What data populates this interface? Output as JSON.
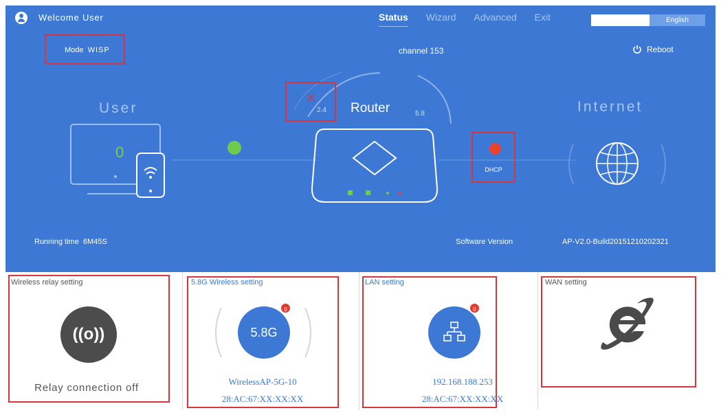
{
  "header": {
    "welcome": "Welcome User",
    "nav": [
      {
        "label": "Status",
        "active": true
      },
      {
        "label": "Wizard",
        "active": false
      },
      {
        "label": "Advanced",
        "active": false
      },
      {
        "label": "Exit",
        "active": false
      }
    ],
    "language": "English"
  },
  "status": {
    "mode_label": "Mode",
    "mode_value": "WISP",
    "channel": "channel 153",
    "reboot": "Reboot",
    "user_label": "User",
    "user_count": "0",
    "router_label": "Router",
    "band_24": "2.4",
    "band_58": "5.8",
    "internet_label": "Internet",
    "wan_type": "DHCP",
    "running_label": "Running time",
    "running_value": "6M45S",
    "software_label": "Software Version",
    "software_value": "AP-V2.0-Build20151210202321"
  },
  "cards": {
    "relay": {
      "title": "Wireless relay setting",
      "status": "Relay connection off"
    },
    "wireless58": {
      "title": "5.8G Wireless setting",
      "badge": "0",
      "icon_text": "5.8G",
      "ssid": "WirelessAP-5G-10",
      "mac": "28:AC:67:XX:XX:XX"
    },
    "lan": {
      "title": "LAN setting",
      "badge": "0",
      "ip": "192.168.188.253",
      "mac": "28:AC:67:XX:XX:XX"
    },
    "wan": {
      "title": "WAN setting"
    }
  },
  "colors": {
    "panel_blue": "#3c78d4",
    "accent_red": "#d9343d",
    "status_green": "#6ecb4f",
    "status_red": "#e8432f"
  },
  "icons": [
    "user-icon",
    "power-icon",
    "monitor-icon",
    "phone-wifi-icon",
    "router-icon",
    "globe-icon",
    "relay-signal-icon",
    "network-icon",
    "ie-icon"
  ]
}
